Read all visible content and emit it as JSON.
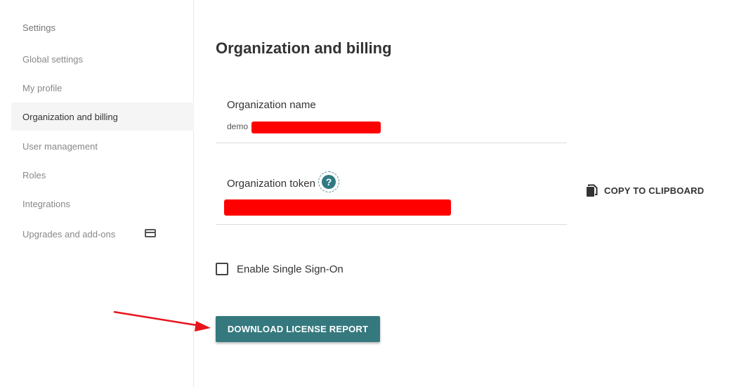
{
  "sidebar": {
    "title": "Settings",
    "items": [
      {
        "label": "Global settings"
      },
      {
        "label": "My profile"
      },
      {
        "label": "Organization and billing"
      },
      {
        "label": "User management"
      },
      {
        "label": "Roles"
      },
      {
        "label": "Integrations"
      },
      {
        "label": "Upgrades and add-ons",
        "icon": "credit-card-icon"
      }
    ],
    "active_item": "Organization and billing"
  },
  "main": {
    "title": "Organization and billing",
    "org_name": {
      "label": "Organization name",
      "value": "demo"
    },
    "org_token": {
      "label": "Organization token",
      "help_icon": "question-mark-icon"
    },
    "copy_button": {
      "label": "COPY TO CLIPBOARD",
      "icon": "copy-icon"
    },
    "sso_checkbox": {
      "label": "Enable Single Sign-On",
      "checked": false
    },
    "download_button": {
      "label": "DOWNLOAD LICENSE REPORT"
    }
  },
  "annotation": {
    "arrow_color": "#e8141c"
  },
  "colors": {
    "accent": "#35797f",
    "redaction": "#ff0000"
  }
}
